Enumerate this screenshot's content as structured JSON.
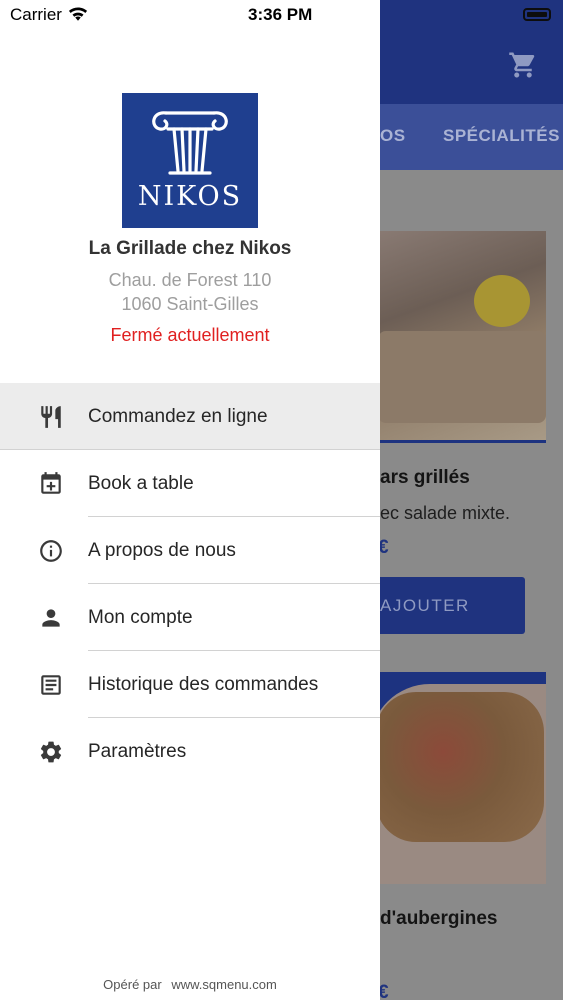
{
  "status_bar": {
    "carrier": "Carrier",
    "time": "3:36 PM"
  },
  "restaurant": {
    "logo_text": "NIKOS",
    "name": "La Grillade chez Nikos",
    "address_line1": "Chau. de Forest 110",
    "address_line2": "1060 Saint-Gilles",
    "status": "Fermé actuellement"
  },
  "menu": {
    "items": [
      {
        "label": "Commandez en ligne",
        "icon": "fork-knife-icon",
        "active": true
      },
      {
        "label": "Book a table",
        "icon": "calendar-plus-icon",
        "active": false
      },
      {
        "label": "A propos de nous",
        "icon": "info-icon",
        "active": false
      },
      {
        "label": "Mon compte",
        "icon": "person-icon",
        "active": false
      },
      {
        "label": "Historique des commandes",
        "icon": "list-document-icon",
        "active": false
      },
      {
        "label": "Paramètres",
        "icon": "gear-icon",
        "active": false
      }
    ]
  },
  "footer": {
    "prefix": "Opéré par",
    "link": "www.sqmenu.com"
  },
  "background": {
    "tabs": [
      "OS",
      "SPÉCIALITÉS"
    ],
    "item1": {
      "title": "ars grillés",
      "description": "ec salade mixte.",
      "price": "€"
    },
    "add_button": "AJOUTER",
    "item2": {
      "title": "d'aubergines",
      "price": "€"
    }
  },
  "colors": {
    "brand": "#1f337f",
    "logo_bg": "#1f3f8f",
    "closed": "#e02020",
    "active_row": "#ececec"
  }
}
